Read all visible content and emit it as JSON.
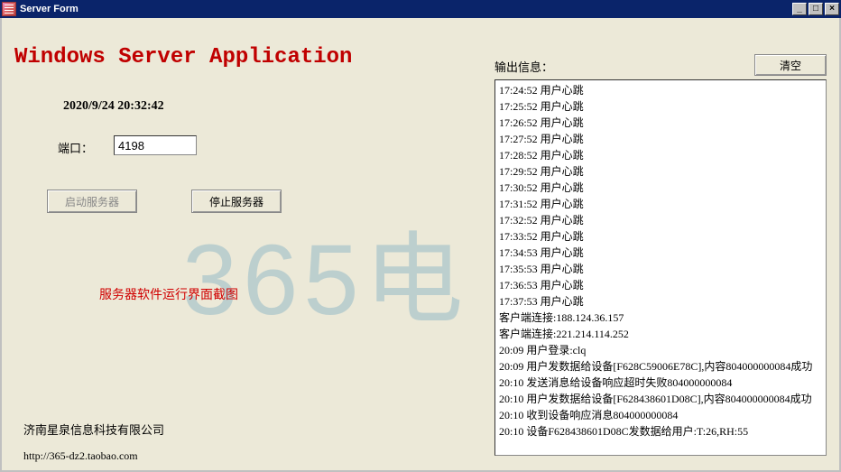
{
  "window": {
    "title": "Server Form"
  },
  "heading": "Windows Server Application",
  "datetime": "2020/9/24 20:32:42",
  "port": {
    "label": "端口：",
    "value": "4198"
  },
  "buttons": {
    "start": "启动服务器",
    "stop": "停止服务器",
    "clear": "清空"
  },
  "caption": "服务器软件运行界面截图",
  "company": "济南星泉信息科技有限公司",
  "url": "http://365-dz2.taobao.com",
  "output_label": "输出信息：",
  "watermark": "365电",
  "log": [
    "17:24:52 用户心跳",
    "17:25:52 用户心跳",
    "17:26:52 用户心跳",
    "17:27:52 用户心跳",
    "17:28:52 用户心跳",
    "17:29:52 用户心跳",
    "17:30:52 用户心跳",
    "17:31:52 用户心跳",
    "17:32:52 用户心跳",
    "17:33:52 用户心跳",
    "17:34:53 用户心跳",
    "17:35:53 用户心跳",
    "17:36:53 用户心跳",
    "17:37:53 用户心跳",
    "客户端连接:188.124.36.157",
    "客户端连接:221.214.114.252",
    "20:09 用户登录:clq",
    "20:09 用户发数据给设备[F628C59006E78C],内容804000000084成功",
    "20:10 发送消息给设备响应超时失败804000000084",
    "20:10 用户发数据给设备[F628438601D08C],内容804000000084成功",
    "20:10 收到设备响应消息804000000084",
    "20:10 设备F628438601D08C发数据给用户:T:26,RH:55"
  ]
}
